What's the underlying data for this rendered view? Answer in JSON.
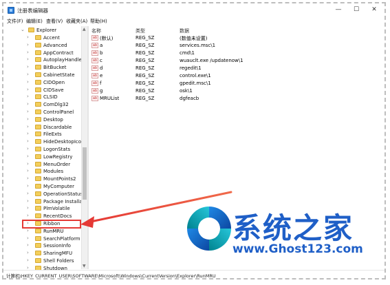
{
  "window": {
    "title": "注册表编辑器",
    "min_glyph": "—",
    "max_glyph": "☐",
    "close_glyph": "✕"
  },
  "menu": {
    "items": [
      "文件(F)",
      "编辑(E)",
      "查看(V)",
      "收藏夹(A)",
      "帮助(H)"
    ]
  },
  "tree": {
    "root": "Explorer",
    "items": [
      "Accent",
      "Advanced",
      "AppContract",
      "AutoplayHandlers",
      "BitBucket",
      "CabinetState",
      "CIDOpen",
      "CIDSave",
      "CLSID",
      "ComDlg32",
      "ControlPanel",
      "Desktop",
      "Discardable",
      "FileExts",
      "HideDesktopIcons",
      "LogonStats",
      "LowRegistry",
      "MenuOrder",
      "Modules",
      "MountPoints2",
      "MyComputer",
      "OperationStatusM",
      "Package Installati",
      "PlmVolatile",
      "RecentDocs",
      "Ribbon",
      "RunMRU",
      "SearchPlatform",
      "SessionInfo",
      "SharingMFU",
      "Shell Folders",
      "Shutdown"
    ],
    "selected": "RunMRU"
  },
  "values_pane": {
    "headers": {
      "name": "名称",
      "type": "类型",
      "data": "数据"
    },
    "rows": [
      {
        "name": "(默认)",
        "type": "REG_SZ",
        "data": "(数值未设置)"
      },
      {
        "name": "a",
        "type": "REG_SZ",
        "data": "services.msc\\1"
      },
      {
        "name": "b",
        "type": "REG_SZ",
        "data": "cmd\\1"
      },
      {
        "name": "c",
        "type": "REG_SZ",
        "data": "wuauclt.exe /updatenow\\1"
      },
      {
        "name": "d",
        "type": "REG_SZ",
        "data": "regedit\\1"
      },
      {
        "name": "e",
        "type": "REG_SZ",
        "data": "control.exe\\1"
      },
      {
        "name": "f",
        "type": "REG_SZ",
        "data": "gpedit.msc\\1"
      },
      {
        "name": "g",
        "type": "REG_SZ",
        "data": "osk\\1"
      },
      {
        "name": "MRUList",
        "type": "REG_SZ",
        "data": "dgfeacb"
      }
    ],
    "value_icon_text": "ab"
  },
  "status": {
    "path": "计算机\\HKEY_CURRENT_USER\\SOFTWARE\\Microsoft\\Windows\\CurrentVersion\\Explorer\\RunMRU"
  },
  "watermark": {
    "brand": "系统之家",
    "url": "www.Ghost123.com"
  },
  "colors": {
    "highlight": "#e53935",
    "brand_blue": "#1f5fc7"
  }
}
